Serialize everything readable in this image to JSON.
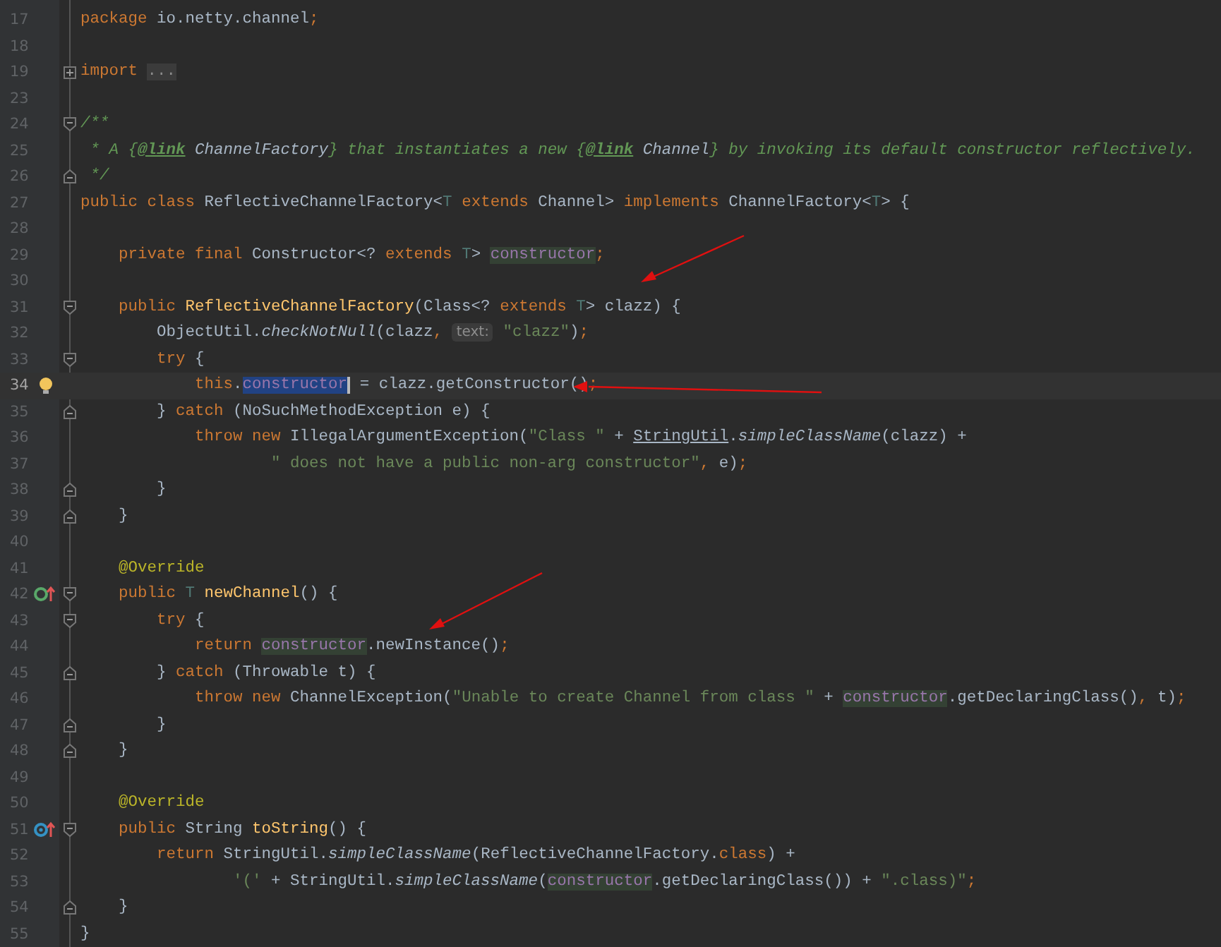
{
  "editor": {
    "lines": [
      {
        "number": "17",
        "current": false,
        "tokens": [
          {
            "text": "package",
            "kind": "keyword"
          },
          {
            "text": " io.netty.channel",
            "kind": "plain"
          },
          {
            "text": ";",
            "kind": "keyword"
          }
        ]
      },
      {
        "number": "18",
        "current": false
      },
      {
        "number": "19",
        "current": false,
        "gutter": [
          {
            "kind": "fold-collapsed"
          }
        ],
        "tokens": [
          {
            "text": "import ",
            "kind": "keyword"
          },
          {
            "text": "...",
            "kind": "folded"
          }
        ]
      },
      {
        "number": "23",
        "current": false
      },
      {
        "number": "24",
        "current": false,
        "gutter": [
          {
            "kind": "fold-start"
          }
        ],
        "tokens": [
          {
            "text": "/**",
            "kind": "comment"
          }
        ]
      },
      {
        "number": "25",
        "current": false,
        "tokens": [
          {
            "text": " * A {",
            "kind": "comment"
          },
          {
            "text": "@link",
            "kind": "doc-tag"
          },
          {
            "text": " ChannelFactory",
            "kind": "doc-ref"
          },
          {
            "text": "} that instantiates a new {",
            "kind": "comment"
          },
          {
            "text": "@link",
            "kind": "doc-tag"
          },
          {
            "text": " Channel",
            "kind": "doc-ref"
          },
          {
            "text": "} by invoking its default constructor reflectively.",
            "kind": "comment"
          }
        ]
      },
      {
        "number": "26",
        "current": false,
        "gutter": [
          {
            "kind": "fold-end"
          }
        ],
        "tokens": [
          {
            "text": " */",
            "kind": "comment"
          }
        ]
      },
      {
        "number": "27",
        "current": false,
        "tokens": [
          {
            "text": "public class ",
            "kind": "keyword"
          },
          {
            "text": "ReflectiveChannelFactory<",
            "kind": "plain"
          },
          {
            "text": "T",
            "kind": "type-param"
          },
          {
            "text": " extends ",
            "kind": "keyword"
          },
          {
            "text": "Channel> ",
            "kind": "plain"
          },
          {
            "text": "implements ",
            "kind": "keyword"
          },
          {
            "text": "ChannelFactory<",
            "kind": "plain"
          },
          {
            "text": "T",
            "kind": "type-param"
          },
          {
            "text": "> {",
            "kind": "plain"
          }
        ]
      },
      {
        "number": "28",
        "current": false
      },
      {
        "number": "29",
        "current": false,
        "tokens": [
          {
            "text": "    private final ",
            "kind": "keyword"
          },
          {
            "text": "Constructor<? ",
            "kind": "plain"
          },
          {
            "text": "extends ",
            "kind": "keyword"
          },
          {
            "text": "T",
            "kind": "type-param"
          },
          {
            "text": "> ",
            "kind": "plain"
          },
          {
            "text": "constructor",
            "kind": "usage"
          },
          {
            "text": ";",
            "kind": "keyword"
          }
        ]
      },
      {
        "number": "30",
        "current": false
      },
      {
        "number": "31",
        "current": false,
        "gutter": [
          {
            "kind": "fold-start"
          }
        ],
        "tokens": [
          {
            "text": "    public ",
            "kind": "keyword"
          },
          {
            "text": "ReflectiveChannelFactory",
            "kind": "declaration"
          },
          {
            "text": "(Class<? ",
            "kind": "plain"
          },
          {
            "text": "extends ",
            "kind": "keyword"
          },
          {
            "text": "T",
            "kind": "type-param"
          },
          {
            "text": "> clazz) {",
            "kind": "plain"
          }
        ]
      },
      {
        "number": "32",
        "current": false,
        "tokens": [
          {
            "text": "        ObjectUtil.",
            "kind": "plain"
          },
          {
            "text": "checkNotNull",
            "kind": "static"
          },
          {
            "text": "(clazz",
            "kind": "plain"
          },
          {
            "text": ", ",
            "kind": "keyword"
          },
          {
            "text": "text:",
            "kind": "hint"
          },
          {
            "text": " \"clazz\"",
            "kind": "string"
          },
          {
            "text": ")",
            "kind": "plain"
          },
          {
            "text": ";",
            "kind": "keyword"
          }
        ]
      },
      {
        "number": "33",
        "current": false,
        "gutter": [
          {
            "kind": "fold-start"
          }
        ],
        "tokens": [
          {
            "text": "        try",
            "kind": "keyword"
          },
          {
            "text": " {",
            "kind": "plain"
          }
        ]
      },
      {
        "number": "34",
        "current": true,
        "gutter": [
          {
            "kind": "bulb"
          }
        ],
        "tokens": [
          {
            "text": "            this",
            "kind": "keyword"
          },
          {
            "text": ".",
            "kind": "plain"
          },
          {
            "text": "constructor",
            "kind": "selection"
          },
          {
            "text": " = clazz.getConstructor()",
            "kind": "plain"
          },
          {
            "text": ";",
            "kind": "keyword"
          }
        ]
      },
      {
        "number": "35",
        "current": false,
        "gutter": [
          {
            "kind": "fold-end"
          }
        ],
        "tokens": [
          {
            "text": "        } ",
            "kind": "plain"
          },
          {
            "text": "catch",
            "kind": "keyword"
          },
          {
            "text": " (NoSuchMethodException e) {",
            "kind": "plain"
          }
        ]
      },
      {
        "number": "36",
        "current": false,
        "tokens": [
          {
            "text": "            throw new ",
            "kind": "keyword"
          },
          {
            "text": "IllegalArgumentException(",
            "kind": "plain"
          },
          {
            "text": "\"Class \"",
            "kind": "string"
          },
          {
            "text": " + ",
            "kind": "plain"
          },
          {
            "text": "StringUtil",
            "kind": "link"
          },
          {
            "text": ".",
            "kind": "plain"
          },
          {
            "text": "simpleClassName",
            "kind": "static"
          },
          {
            "text": "(clazz) +",
            "kind": "plain"
          }
        ]
      },
      {
        "number": "37",
        "current": false,
        "tokens": [
          {
            "text": "                    \" does not have a public non-arg constructor\"",
            "kind": "string"
          },
          {
            "text": ",",
            "kind": "keyword"
          },
          {
            "text": " e)",
            "kind": "plain"
          },
          {
            "text": ";",
            "kind": "keyword"
          }
        ]
      },
      {
        "number": "38",
        "current": false,
        "gutter": [
          {
            "kind": "fold-end"
          }
        ],
        "tokens": [
          {
            "text": "        }",
            "kind": "plain"
          }
        ]
      },
      {
        "number": "39",
        "current": false,
        "gutter": [
          {
            "kind": "fold-end"
          }
        ],
        "tokens": [
          {
            "text": "    }",
            "kind": "plain"
          }
        ]
      },
      {
        "number": "40",
        "current": false
      },
      {
        "number": "41",
        "current": false,
        "tokens": [
          {
            "text": "    @Override",
            "kind": "annotation"
          }
        ]
      },
      {
        "number": "42",
        "current": false,
        "gutter": [
          {
            "kind": "implements"
          },
          {
            "kind": "fold-start"
          }
        ],
        "tokens": [
          {
            "text": "    public ",
            "kind": "keyword"
          },
          {
            "text": "T ",
            "kind": "type-param"
          },
          {
            "text": "newChannel",
            "kind": "declaration"
          },
          {
            "text": "() {",
            "kind": "plain"
          }
        ]
      },
      {
        "number": "43",
        "current": false,
        "gutter": [
          {
            "kind": "fold-start"
          }
        ],
        "tokens": [
          {
            "text": "        try",
            "kind": "keyword"
          },
          {
            "text": " {",
            "kind": "plain"
          }
        ]
      },
      {
        "number": "44",
        "current": false,
        "tokens": [
          {
            "text": "            return ",
            "kind": "keyword"
          },
          {
            "text": "constructor",
            "kind": "usage"
          },
          {
            "text": ".newInstance()",
            "kind": "plain"
          },
          {
            "text": ";",
            "kind": "keyword"
          }
        ]
      },
      {
        "number": "45",
        "current": false,
        "gutter": [
          {
            "kind": "fold-end"
          }
        ],
        "tokens": [
          {
            "text": "        } ",
            "kind": "plain"
          },
          {
            "text": "catch",
            "kind": "keyword"
          },
          {
            "text": " (Throwable t) {",
            "kind": "plain"
          }
        ]
      },
      {
        "number": "46",
        "current": false,
        "tokens": [
          {
            "text": "            throw new ",
            "kind": "keyword"
          },
          {
            "text": "ChannelException(",
            "kind": "plain"
          },
          {
            "text": "\"Unable to create Channel from class \"",
            "kind": "string"
          },
          {
            "text": " + ",
            "kind": "plain"
          },
          {
            "text": "constructor",
            "kind": "usage"
          },
          {
            "text": ".getDeclaringClass()",
            "kind": "plain"
          },
          {
            "text": ",",
            "kind": "keyword"
          },
          {
            "text": " t)",
            "kind": "plain"
          },
          {
            "text": ";",
            "kind": "keyword"
          }
        ]
      },
      {
        "number": "47",
        "current": false,
        "gutter": [
          {
            "kind": "fold-end"
          }
        ],
        "tokens": [
          {
            "text": "        }",
            "kind": "plain"
          }
        ]
      },
      {
        "number": "48",
        "current": false,
        "gutter": [
          {
            "kind": "fold-end"
          }
        ],
        "tokens": [
          {
            "text": "    }",
            "kind": "plain"
          }
        ]
      },
      {
        "number": "49",
        "current": false
      },
      {
        "number": "50",
        "current": false,
        "tokens": [
          {
            "text": "    @Override",
            "kind": "annotation"
          }
        ]
      },
      {
        "number": "51",
        "current": false,
        "gutter": [
          {
            "kind": "overrides"
          },
          {
            "kind": "fold-start"
          }
        ],
        "tokens": [
          {
            "text": "    public ",
            "kind": "keyword"
          },
          {
            "text": "String ",
            "kind": "plain"
          },
          {
            "text": "toString",
            "kind": "declaration"
          },
          {
            "text": "() {",
            "kind": "plain"
          }
        ]
      },
      {
        "number": "52",
        "current": false,
        "tokens": [
          {
            "text": "        return ",
            "kind": "keyword"
          },
          {
            "text": "StringUtil.",
            "kind": "plain"
          },
          {
            "text": "simpleClassName",
            "kind": "static"
          },
          {
            "text": "(ReflectiveChannelFactory.",
            "kind": "plain"
          },
          {
            "text": "class",
            "kind": "keyword"
          },
          {
            "text": ") +",
            "kind": "plain"
          }
        ]
      },
      {
        "number": "53",
        "current": false,
        "tokens": [
          {
            "text": "                '('",
            "kind": "string"
          },
          {
            "text": " + StringUtil.",
            "kind": "plain"
          },
          {
            "text": "simpleClassName",
            "kind": "static"
          },
          {
            "text": "(",
            "kind": "plain"
          },
          {
            "text": "constructor",
            "kind": "usage"
          },
          {
            "text": ".getDeclaringClass()) + ",
            "kind": "plain"
          },
          {
            "text": "\".class)\"",
            "kind": "string"
          },
          {
            "text": ";",
            "kind": "keyword"
          }
        ]
      },
      {
        "number": "54",
        "current": false,
        "gutter": [
          {
            "kind": "fold-end"
          }
        ],
        "tokens": [
          {
            "text": "    }",
            "kind": "plain"
          }
        ]
      },
      {
        "number": "55",
        "current": false,
        "tokens": [
          {
            "text": "}",
            "kind": "plain"
          }
        ]
      }
    ]
  }
}
